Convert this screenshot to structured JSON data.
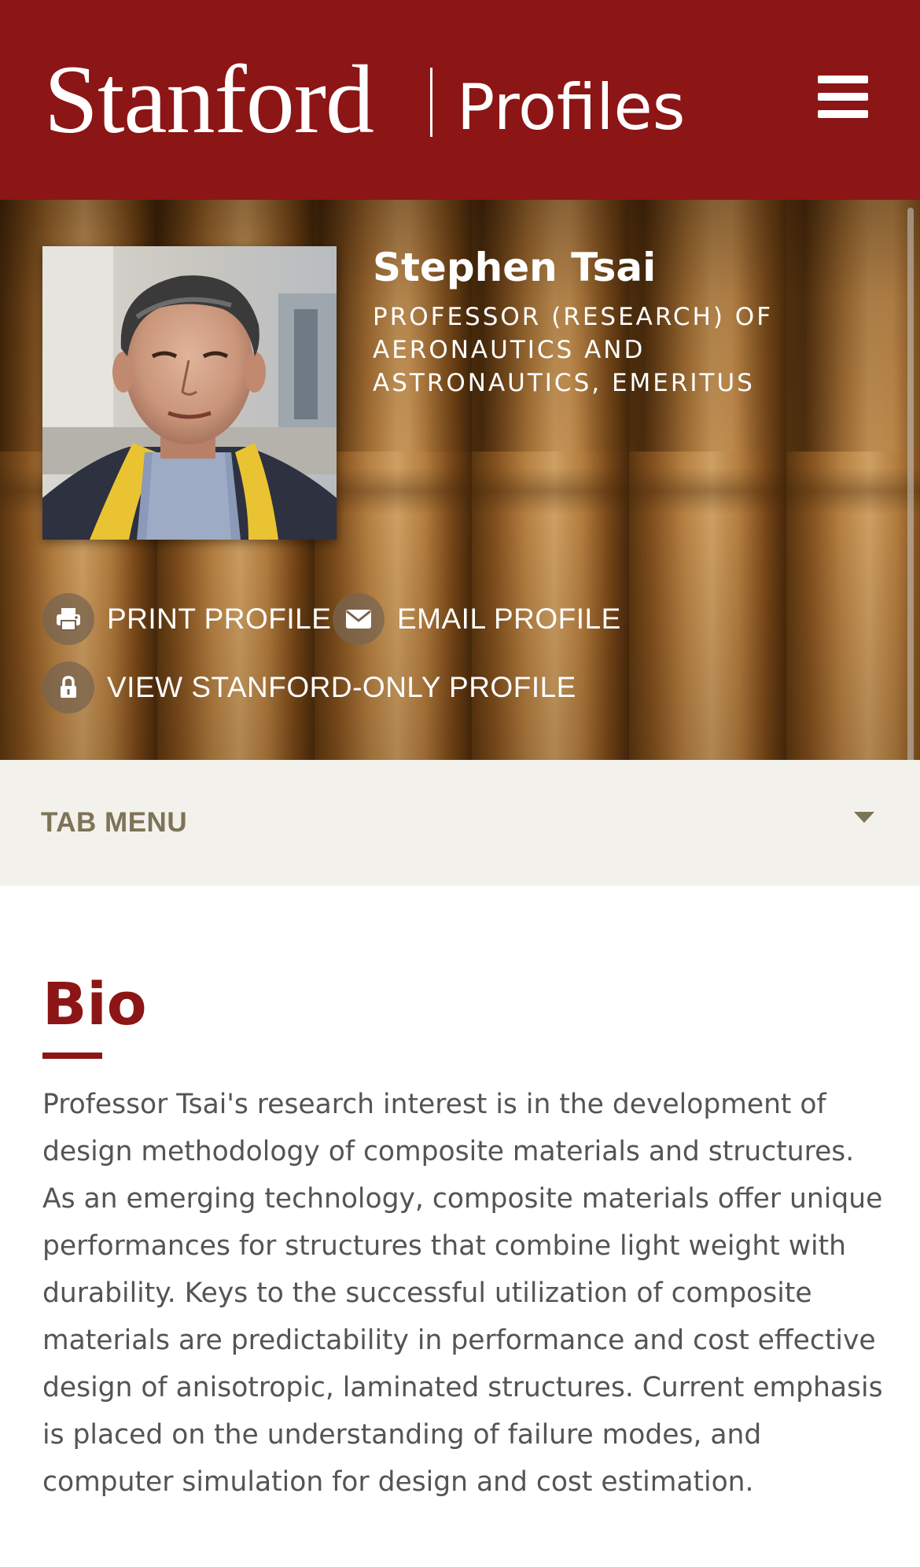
{
  "header": {
    "brand": "Stanford",
    "section": "Profiles",
    "menu_icon": "hamburger-menu-icon",
    "bg_color": "#8c1515"
  },
  "profile": {
    "name": "Stephen Tsai",
    "title": "Professor (Research) of Aeronautics and Astronautics, Emeritus",
    "photo": "profile-photo"
  },
  "actions": [
    {
      "label": "PRINT PROFILE",
      "icon": "printer-icon"
    },
    {
      "label": "EMAIL PROFILE",
      "icon": "envelope-icon"
    },
    {
      "label": "VIEW STANFORD-ONLY PROFILE",
      "icon": "lock-icon"
    }
  ],
  "tab_menu": {
    "label": "TAB MENU",
    "icon": "caret-down-icon"
  },
  "bio": {
    "heading": "Bio",
    "text": "Professor Tsai's research interest is in the development of design methodology of composite materials and structures. As an emerging technology, composite materials offer unique performances for structures that combine light weight with durability. Keys to the successful utilization of composite materials are predictability in performance and cost effective design of anisotropic, laminated structures. Current emphasis is placed on the understanding of failure modes, and computer simulation for design and cost estimation."
  },
  "colors": {
    "cardinal": "#8c1515",
    "tab_bg": "#f2f1ec",
    "tab_text": "#7d7356",
    "body_text": "#545454"
  }
}
